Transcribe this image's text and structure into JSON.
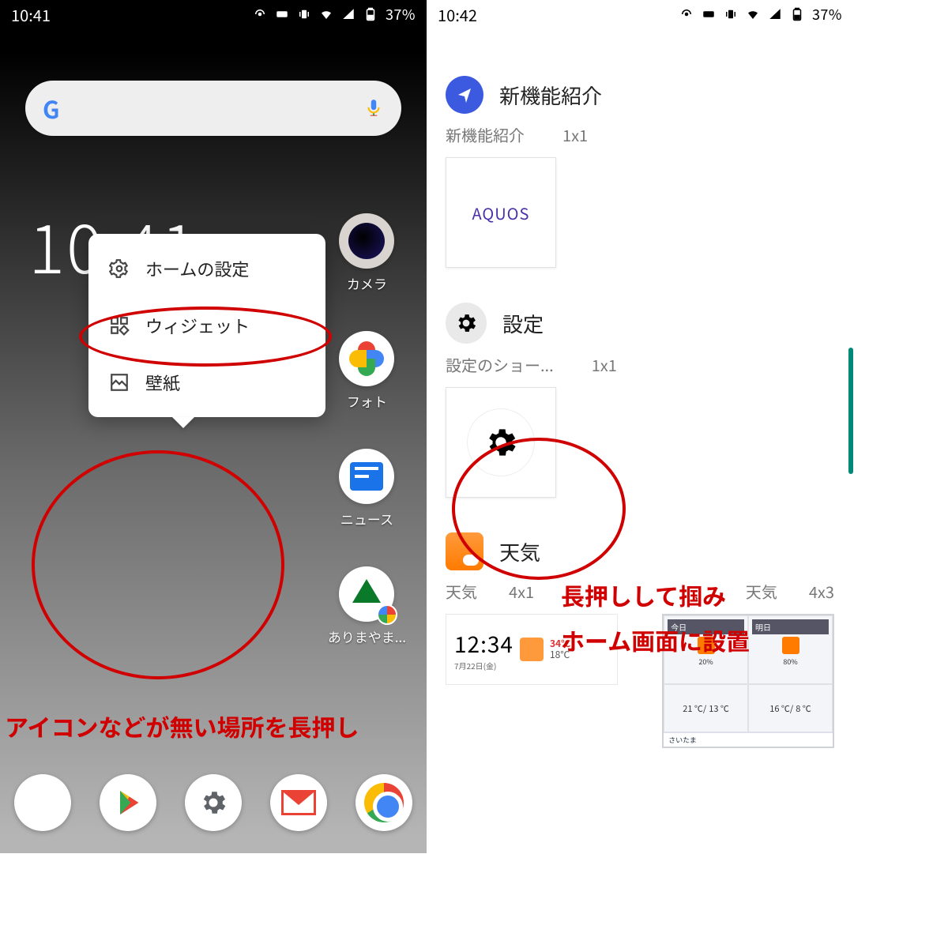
{
  "left": {
    "statusbar": {
      "time": "10:41",
      "battery": "37%"
    },
    "clock": "10:41",
    "ctx_menu": {
      "settings": "ホームの設定",
      "widgets": "ウィジェット",
      "wallpaper": "壁紙"
    },
    "apps": {
      "camera": "カメラ",
      "photos": "フォト",
      "news": "ニュース",
      "arimayama": "ありまやま..."
    },
    "annotation": "アイコンなどが無い場所を長押し"
  },
  "right": {
    "statusbar": {
      "time": "10:42",
      "battery": "37%"
    },
    "groups": {
      "newfeatures": {
        "header": "新機能紹介",
        "name": "新機能紹介",
        "size": "1x1",
        "aquos": "AQUOS"
      },
      "settings": {
        "header": "設定",
        "name": "設定のショー...",
        "size": "1x1"
      },
      "weather": {
        "header": "天気",
        "name_a": "天気",
        "size_a": "4x1",
        "name_b": "天気",
        "size_b": "4x3",
        "preview41": {
          "time": "12:34",
          "hi": "34℃",
          "lo": "18℃",
          "date": "7月22日(金)"
        },
        "preview43": {
          "day1": "今日",
          "day2": "明日",
          "p1": "20%",
          "p2": "80%",
          "t1a": "21 ℃/",
          "t1b": "13 ℃",
          "t2a": "16 ℃/",
          "t2b": "8 ℃",
          "loc": "さいたま"
        }
      }
    },
    "annotation_line1": "長押しして掴み",
    "annotation_line2": "ホーム画面に設置"
  }
}
